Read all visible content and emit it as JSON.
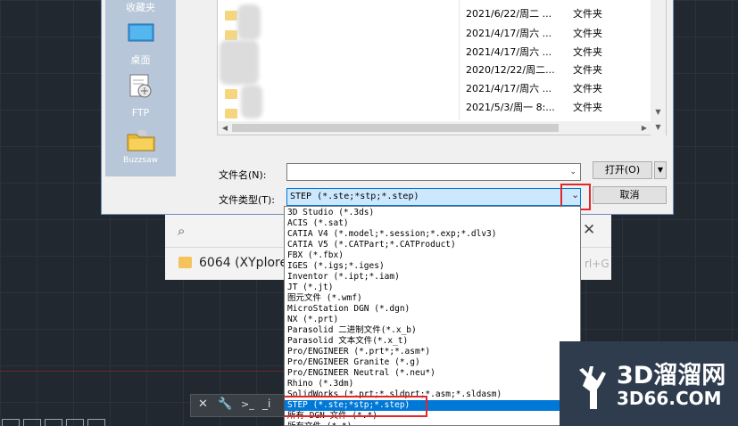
{
  "places": [
    {
      "label": "收藏夹",
      "icon": "favorites-icon"
    },
    {
      "label": "桌面",
      "icon": "desktop-icon"
    },
    {
      "label": "FTP",
      "icon": "ftp-icon"
    },
    {
      "label": "Buzzsaw",
      "icon": "buzzsaw-folder-icon"
    }
  ],
  "files": [
    {
      "date": "2021/6/22/周二 ...",
      "type": "文件夹"
    },
    {
      "date": "2021/4/17/周六 ...",
      "type": "文件夹"
    },
    {
      "date": "2021/4/17/周六 ...",
      "type": "文件夹"
    },
    {
      "date": "2020/12/22/周二...",
      "type": "文件夹"
    },
    {
      "date": "2021/4/17/周六 ...",
      "type": "文件夹"
    },
    {
      "date": "2021/5/3/周一 8:...",
      "type": "文件夹"
    }
  ],
  "filename_label": "文件名(N):",
  "filename_value": "",
  "filetype_label": "文件类型(T):",
  "filetype_value": "STEP (*.ste;*stp;*.step)",
  "open_button": "打开(O)",
  "cancel_button": "取消",
  "filetype_options": [
    "3D Studio (*.3ds)",
    "ACIS (*.sat)",
    "CATIA V4 (*.model;*.session;*.exp;*.dlv3)",
    "CATIA V5 (*.CATPart;*.CATProduct)",
    "FBX (*.fbx)",
    "IGES (*.igs;*.iges)",
    "Inventor (*.ipt;*.iam)",
    "JT (*.jt)",
    "图元文件 (*.wmf)",
    "MicroStation DGN (*.dgn)",
    "NX (*.prt)",
    "Parasolid 二进制文件(*.x_b)",
    "Parasolid 文本文件(*.x_t)",
    "Pro/ENGINEER (*.prt*;*.asm*)",
    "Pro/ENGINEER Granite (*.g)",
    "Pro/ENGINEER Neutral (*.neu*)",
    "Rhino (*.3dm)",
    "SolidWorks (*.prt;*.sldprt;*.asm;*.sldasm)",
    "STEP (*.ste;*stp;*.step)",
    "所有 DGN 文件 (*.*)",
    "所有文件 (*.*)"
  ],
  "selected_option_index": 18,
  "background_window": {
    "item_name": "6064 (XYplore",
    "shortcut": "rl+G"
  },
  "command_bar": {
    "text": "_i"
  },
  "watermark": {
    "brand": "3D溜溜网",
    "site": "3D66.COM"
  },
  "colors": {
    "accent": "#0078d7",
    "highlight_box": "#e2262e",
    "places_bg": "#b7c6d8"
  }
}
